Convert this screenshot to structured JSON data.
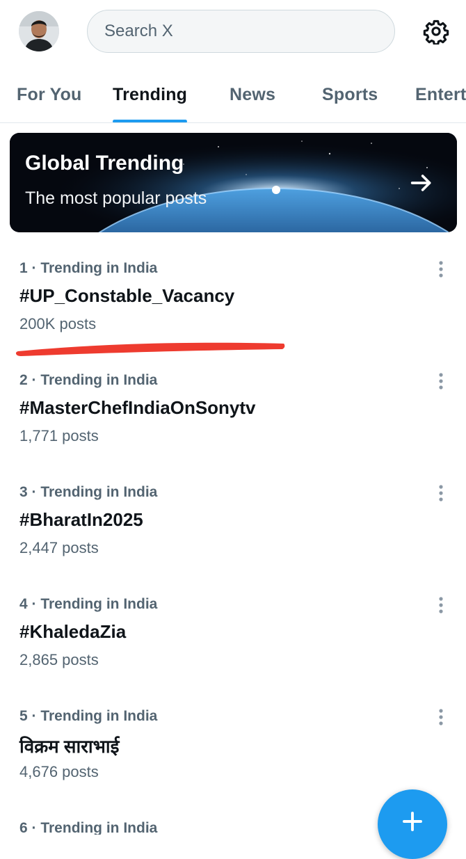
{
  "search": {
    "placeholder": "Search X"
  },
  "tabs": [
    {
      "label": "For You"
    },
    {
      "label": "Trending"
    },
    {
      "label": "News"
    },
    {
      "label": "Sports"
    },
    {
      "label": "Entert"
    }
  ],
  "active_tab": "Trending",
  "banner": {
    "title": "Global Trending",
    "subtitle": "The most popular posts"
  },
  "trends": [
    {
      "meta": "1 · Trending in India",
      "name": "#UP_Constable_Vacancy",
      "count": "200K posts"
    },
    {
      "meta": "2 · Trending in India",
      "name": "#MasterChefIndiaOnSonytv",
      "count": "1,771 posts"
    },
    {
      "meta": "3 · Trending in India",
      "name": "#BharatIn2025",
      "count": "2,447 posts"
    },
    {
      "meta": "4 · Trending in India",
      "name": "#KhaledaZia",
      "count": "2,865 posts"
    },
    {
      "meta": "5 · Trending in India",
      "name": "विक्रम साराभाई",
      "count": "4,676 posts"
    },
    {
      "meta": "6 · Trending in India",
      "name": "",
      "count": ""
    }
  ],
  "icons": {
    "header_right": "gear-icon",
    "banner_arrow": "arrow-right-icon",
    "trend_menu": "more-vertical-icon",
    "fab": "plus-icon"
  },
  "colors": {
    "accent": "#1d9bf0",
    "secondary_text": "#536471",
    "highlight_mark": "#ee3b2f"
  }
}
